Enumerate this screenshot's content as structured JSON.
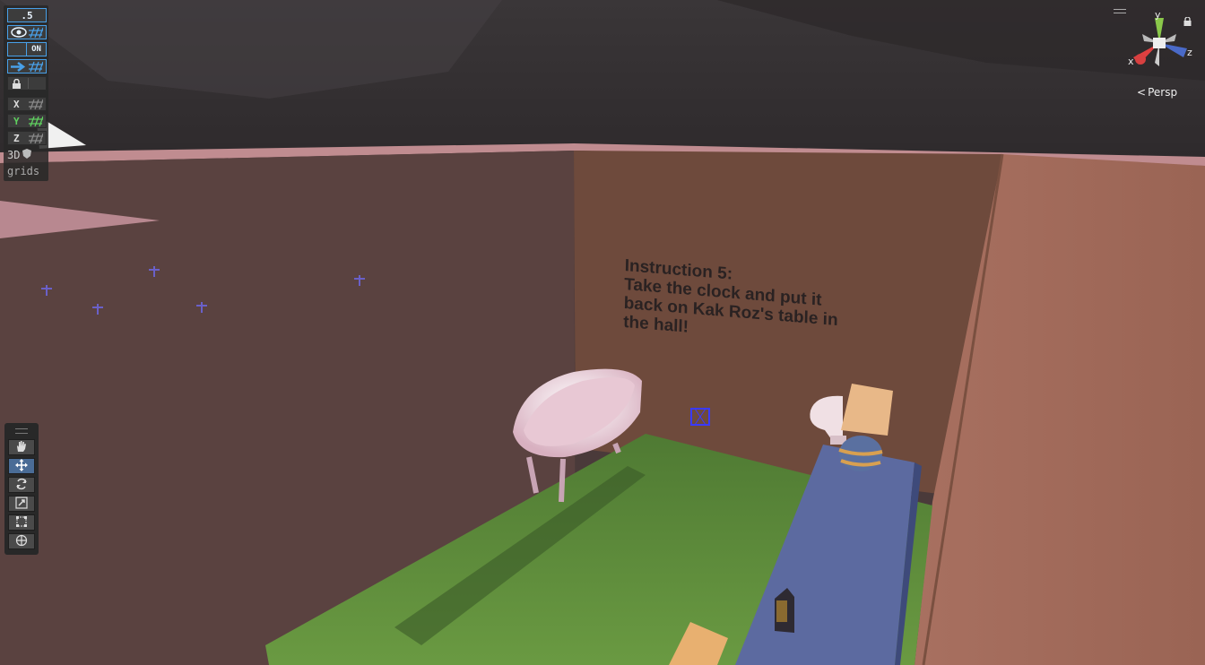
{
  "grid_panel": {
    "snap_value": ".5",
    "toggle_label": "ON",
    "axis_x": "X",
    "axis_y": "Y",
    "axis_z": "Z",
    "mode_3d": "3D",
    "grids_label": "grids"
  },
  "tools": [
    "view-tool",
    "move-tool",
    "rotate-tool",
    "scale-tool",
    "rect-tool",
    "transform-tool"
  ],
  "active_tool": "move-tool",
  "gizmo": {
    "x_label": "x",
    "y_label": "y",
    "z_label": "z",
    "projection_label": "Persp"
  },
  "scene": {
    "instruction_text": "Instruction 5:\nTake the clock and put it\nback on Kak Roz's table in\nthe hall!"
  },
  "colors": {
    "accent_blue": "#48a0e8",
    "y_green": "#5fd05f",
    "floor_green": "#5a8a3a",
    "wall_brown": "#6e4a3c",
    "table_blue": "#5c6aa0",
    "sky_dark": "#3a3638"
  }
}
